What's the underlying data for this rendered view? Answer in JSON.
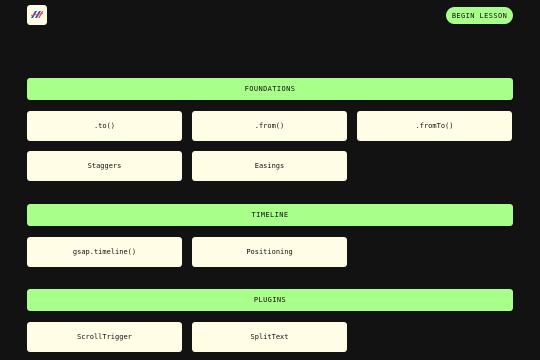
{
  "header": {
    "begin_label": "BEGIN LESSON"
  },
  "colors": {
    "background": "#121212",
    "accent": "#a8ff8a",
    "card": "#fffde6",
    "logo_blue": "#2f4bd7",
    "logo_red": "#e84d3d"
  },
  "sections": [
    {
      "title": "FOUNDATIONS",
      "items": [
        ".to()",
        ".from()",
        ".fromTo()",
        "Staggers",
        "Easings"
      ]
    },
    {
      "title": "TIMELINE",
      "items": [
        "gsap.timeline()",
        "Positioning"
      ]
    },
    {
      "title": "PLUGINS",
      "items": [
        "ScrollTrigger",
        "SplitText"
      ]
    }
  ]
}
